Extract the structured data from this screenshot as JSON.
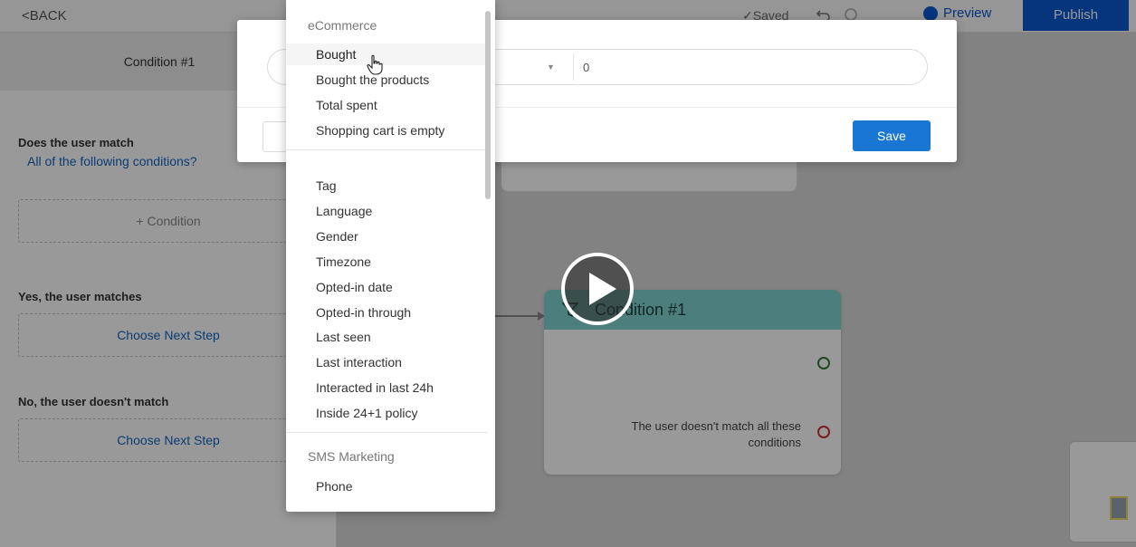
{
  "topbar": {
    "back_label": "<BACK",
    "saved_label": "✓Saved",
    "preview_label": "Preview",
    "publish_label": "Publish"
  },
  "sidebar": {
    "tab_label": "Condition #1",
    "match_label": "Does the user match",
    "match_mode_link": "All of the following conditions?",
    "add_condition_label": "+ Condition",
    "yes_label": "Yes, the user matches",
    "yes_next_step": "Choose Next Step",
    "no_label": "No, the user doesn't match",
    "no_next_step": "Choose Next Step"
  },
  "canvas": {
    "node_title": "Condition #1",
    "node_no_match_text": "The user doesn't match all these conditions",
    "colors": {
      "node_header": "#7fd3ce",
      "yes_dot": "#2e7d32",
      "no_dot": "#d32f2f"
    }
  },
  "modal": {
    "value_input": "0",
    "save_label": "Save",
    "accent": "#1976d2"
  },
  "dropdown": {
    "groups": [
      {
        "label": "eCommerce",
        "items": [
          "Bought",
          "Bought the products",
          "Total spent",
          "Shopping cart is empty"
        ]
      },
      {
        "label": "",
        "items": [
          "Tag",
          "Language",
          "Gender",
          "Timezone",
          "Opted-in date",
          "Opted-in through",
          "Last seen",
          "Last interaction",
          "Interacted in last 24h",
          "Inside 24+1 policy"
        ]
      },
      {
        "label": "SMS Marketing",
        "items": [
          "Phone"
        ]
      }
    ],
    "hovered_item": "Bought"
  },
  "icons": {
    "back": "chevron-left-icon",
    "undo": "undo-icon",
    "redo": "redo-icon",
    "preview": "messenger-icon",
    "node": "filter-icon",
    "cursor": "hand-pointer-icon",
    "play": "play-icon"
  }
}
